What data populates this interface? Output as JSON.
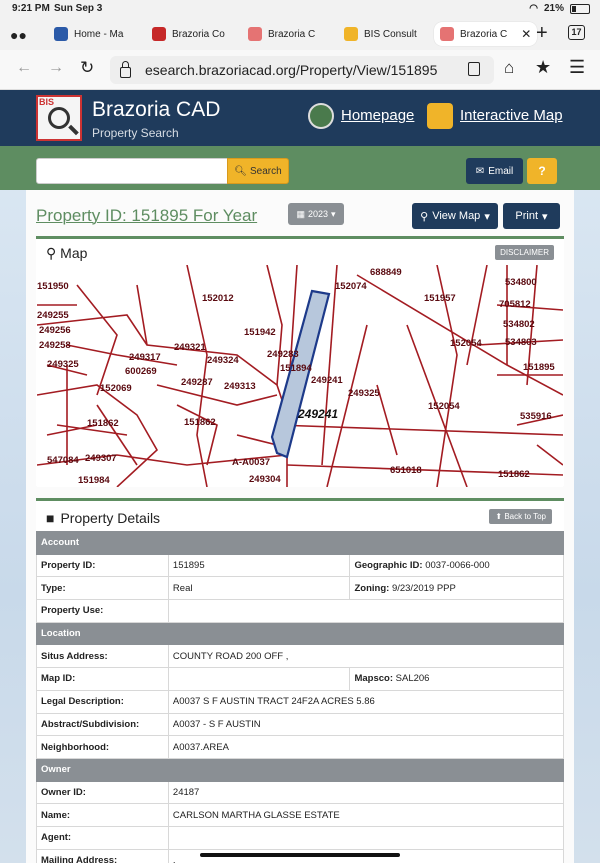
{
  "status_bar": {
    "time": "9:21 PM",
    "date": "Sun Sep 3",
    "battery": "21%"
  },
  "browser": {
    "tabs": [
      {
        "label": "Home - Ma",
        "favicon_color": "#2b5aa8"
      },
      {
        "label": "Brazoria Co",
        "favicon_color": "#c62828"
      },
      {
        "label": "Brazoria C",
        "favicon_color": "#e57373"
      },
      {
        "label": "BIS Consult",
        "favicon_color": "#f0b429"
      },
      {
        "label": "Brazoria C",
        "favicon_color": "#e57373",
        "active": true
      }
    ],
    "tab_count": "17",
    "url": "esearch.brazoriacad.org/Property/View/151895"
  },
  "site": {
    "brand": "Brazoria CAD",
    "brand_sub": "Property Search",
    "logo_text": "BIS",
    "homepage_link": "Homepage",
    "map_link": "Interactive Map",
    "search_placeholder": "",
    "search_button": "Search",
    "email_button": "Email",
    "help_button": "?"
  },
  "property": {
    "title": "Property ID: 151895 For Year",
    "year": "2023",
    "view_map_button": "View Map",
    "print_button": "Print"
  },
  "map": {
    "heading": "Map",
    "disclaimer_button": "DISCLAIMER",
    "parcel_labels": [
      "688849",
      "534800",
      "151950",
      "152012",
      "152074",
      "151957",
      "705812",
      "249255",
      "534802",
      "249256",
      "151942",
      "249258",
      "249321",
      "152054",
      "534803",
      "249317",
      "249324",
      "249325",
      "249283",
      "151894",
      "151895",
      "600269",
      "249241",
      "152069",
      "249287",
      "249313",
      "249325",
      "152054",
      "151862",
      "535916",
      "151862",
      "249241",
      "A-A0037",
      "547084",
      "249307",
      "249304",
      "651018",
      "151862",
      "151984",
      "547084"
    ]
  },
  "details": {
    "heading": "Property Details",
    "back_to_top": "Back to Top",
    "rows": [
      {
        "type": "section",
        "label": "Account"
      },
      {
        "label": "Property ID:",
        "value": "151895",
        "label2": "Geographic ID:",
        "value2": "0037-0066-000"
      },
      {
        "label": "Type:",
        "value": "Real",
        "label2": "Zoning:",
        "value2": "9/23/2019 PPP"
      },
      {
        "label": "Property Use:",
        "value": ""
      },
      {
        "type": "section",
        "label": "Location"
      },
      {
        "label": "Situs Address:",
        "value": "COUNTY ROAD 200 OFF   ,"
      },
      {
        "label": "Map ID:",
        "value": "",
        "label2": "Mapsco:",
        "value2": "SAL206"
      },
      {
        "label": "Legal Description:",
        "value": "A0037 S F AUSTIN TRACT 24F2A ACRES 5.86"
      },
      {
        "label": "Abstract/Subdivision:",
        "value": "A0037 - S F AUSTIN"
      },
      {
        "label": "Neighborhood:",
        "value": "A0037.AREA"
      },
      {
        "type": "section",
        "label": "Owner"
      },
      {
        "label": "Owner ID:",
        "value": "24187"
      },
      {
        "label": "Name:",
        "value": "CARLSON MARTHA GLASSE ESTATE"
      },
      {
        "label": "Agent:",
        "value": ""
      },
      {
        "label": "Mailing Address:",
        "value": ","
      }
    ]
  }
}
